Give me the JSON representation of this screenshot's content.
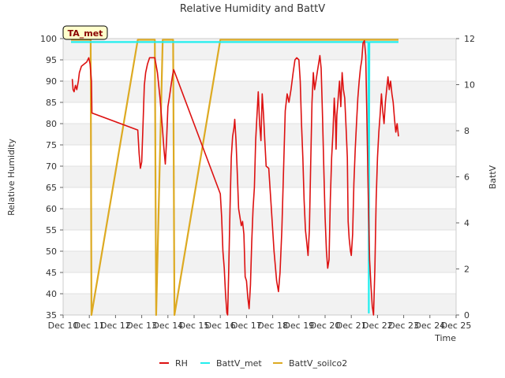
{
  "chart_data": {
    "type": "line",
    "title": "Relative Humidity and BattV",
    "xlabel": "Time",
    "ylabel": "Relative Humidity",
    "y2label": "BattV",
    "annotation": "TA_met",
    "x_range": [
      10,
      25
    ],
    "xtick_labels": [
      "Dec 10",
      "Dec 11",
      "Dec 12",
      "Dec 13",
      "Dec 14",
      "Dec 15",
      "Dec 16",
      "Dec 17",
      "Dec 18",
      "Dec 19",
      "Dec 20",
      "Dec 21",
      "Dec 22",
      "Dec 23",
      "Dec 24",
      "Dec 25"
    ],
    "ylim": [
      35,
      100
    ],
    "yticks": [
      35,
      40,
      45,
      50,
      55,
      60,
      65,
      70,
      75,
      80,
      85,
      90,
      95,
      100
    ],
    "y2lim": [
      0,
      12
    ],
    "y2ticks": [
      0,
      2,
      4,
      6,
      8,
      10,
      12
    ],
    "grid": "horizontal bands",
    "legend_position": "bottom-center",
    "series": [
      {
        "name": "RH",
        "axis": "left",
        "color": "#dd1111",
        "points": [
          [
            10.35,
            90.5
          ],
          [
            10.38,
            88
          ],
          [
            10.42,
            87.5
          ],
          [
            10.47,
            89
          ],
          [
            10.52,
            88
          ],
          [
            10.58,
            90
          ],
          [
            10.62,
            92
          ],
          [
            10.7,
            93.5
          ],
          [
            10.8,
            94
          ],
          [
            10.9,
            94.5
          ],
          [
            10.98,
            95.5
          ],
          [
            11.03,
            94
          ],
          [
            11.08,
            90
          ],
          [
            11.1,
            82.5
          ],
          [
            12.85,
            78.5
          ],
          [
            12.9,
            73
          ],
          [
            12.95,
            69.5
          ],
          [
            13.0,
            71
          ],
          [
            13.05,
            80
          ],
          [
            13.1,
            89
          ],
          [
            13.15,
            92
          ],
          [
            13.22,
            94
          ],
          [
            13.3,
            95.5
          ],
          [
            13.4,
            95.5
          ],
          [
            13.5,
            95.5
          ],
          [
            13.6,
            92
          ],
          [
            13.7,
            86
          ],
          [
            13.8,
            78
          ],
          [
            13.85,
            74
          ],
          [
            13.9,
            70.5
          ],
          [
            13.95,
            76
          ],
          [
            14.0,
            84
          ],
          [
            14.05,
            86
          ],
          [
            14.12,
            89
          ],
          [
            14.18,
            91.5
          ],
          [
            14.22,
            92.7
          ],
          [
            16.0,
            63.5
          ],
          [
            16.05,
            58
          ],
          [
            16.1,
            50
          ],
          [
            16.15,
            46
          ],
          [
            16.2,
            40
          ],
          [
            16.25,
            35.5
          ],
          [
            16.28,
            35
          ],
          [
            16.32,
            45
          ],
          [
            16.37,
            60
          ],
          [
            16.42,
            72
          ],
          [
            16.47,
            77
          ],
          [
            16.52,
            79
          ],
          [
            16.55,
            81
          ],
          [
            16.6,
            76
          ],
          [
            16.65,
            68
          ],
          [
            16.7,
            60
          ],
          [
            16.75,
            58
          ],
          [
            16.8,
            56
          ],
          [
            16.85,
            57
          ],
          [
            16.9,
            54
          ],
          [
            16.95,
            44
          ],
          [
            17.0,
            43
          ],
          [
            17.05,
            39
          ],
          [
            17.1,
            36.5
          ],
          [
            17.15,
            42
          ],
          [
            17.2,
            52
          ],
          [
            17.25,
            60
          ],
          [
            17.3,
            65
          ],
          [
            17.35,
            76
          ],
          [
            17.4,
            82
          ],
          [
            17.45,
            87.5
          ],
          [
            17.5,
            80
          ],
          [
            17.55,
            76
          ],
          [
            17.6,
            87
          ],
          [
            17.65,
            82
          ],
          [
            17.7,
            76
          ],
          [
            17.75,
            70
          ],
          [
            17.85,
            69.5
          ],
          [
            17.95,
            60
          ],
          [
            18.05,
            50
          ],
          [
            18.15,
            43
          ],
          [
            18.22,
            40.5
          ],
          [
            18.28,
            45
          ],
          [
            18.35,
            55
          ],
          [
            18.42,
            70
          ],
          [
            18.48,
            83
          ],
          [
            18.55,
            87
          ],
          [
            18.62,
            85
          ],
          [
            18.7,
            88
          ],
          [
            18.78,
            92
          ],
          [
            18.85,
            95
          ],
          [
            18.92,
            95.5
          ],
          [
            19.0,
            95
          ],
          [
            19.05,
            90
          ],
          [
            19.1,
            80
          ],
          [
            19.15,
            72
          ],
          [
            19.2,
            62
          ],
          [
            19.25,
            55
          ],
          [
            19.3,
            52
          ],
          [
            19.35,
            49
          ],
          [
            19.4,
            55
          ],
          [
            19.45,
            70
          ],
          [
            19.5,
            85
          ],
          [
            19.55,
            92
          ],
          [
            19.6,
            88
          ],
          [
            19.65,
            90
          ],
          [
            19.7,
            92
          ],
          [
            19.75,
            94
          ],
          [
            19.8,
            96
          ],
          [
            19.85,
            93
          ],
          [
            19.9,
            82
          ],
          [
            19.95,
            70
          ],
          [
            20.0,
            58
          ],
          [
            20.05,
            50
          ],
          [
            20.1,
            46
          ],
          [
            20.15,
            48
          ],
          [
            20.2,
            62
          ],
          [
            20.25,
            72
          ],
          [
            20.3,
            78
          ],
          [
            20.35,
            86
          ],
          [
            20.4,
            80
          ],
          [
            20.42,
            74
          ],
          [
            20.45,
            82
          ],
          [
            20.5,
            86
          ],
          [
            20.55,
            90
          ],
          [
            20.6,
            84
          ],
          [
            20.65,
            92
          ],
          [
            20.7,
            88
          ],
          [
            20.75,
            86
          ],
          [
            20.8,
            79
          ],
          [
            20.85,
            72
          ],
          [
            20.88,
            57
          ],
          [
            20.92,
            53
          ],
          [
            20.97,
            50
          ],
          [
            21.0,
            49
          ],
          [
            21.05,
            54
          ],
          [
            21.1,
            66
          ],
          [
            21.15,
            74
          ],
          [
            21.2,
            80
          ],
          [
            21.25,
            86
          ],
          [
            21.3,
            90
          ],
          [
            21.35,
            93
          ],
          [
            21.4,
            95
          ],
          [
            21.45,
            99
          ],
          [
            21.5,
            99.5
          ],
          [
            21.55,
            96
          ],
          [
            21.6,
            80
          ],
          [
            21.65,
            62
          ],
          [
            21.7,
            48
          ],
          [
            21.75,
            42
          ],
          [
            21.8,
            37
          ],
          [
            21.85,
            35
          ],
          [
            21.9,
            46
          ],
          [
            21.95,
            62
          ],
          [
            22.0,
            72
          ],
          [
            22.05,
            78
          ],
          [
            22.1,
            82
          ],
          [
            22.15,
            87
          ],
          [
            22.2,
            83
          ],
          [
            22.25,
            80
          ],
          [
            22.3,
            85
          ],
          [
            22.35,
            88
          ],
          [
            22.4,
            91
          ],
          [
            22.45,
            88
          ],
          [
            22.5,
            90
          ],
          [
            22.55,
            87
          ],
          [
            22.6,
            85
          ],
          [
            22.65,
            81
          ],
          [
            22.7,
            78
          ],
          [
            22.75,
            80
          ],
          [
            22.8,
            77
          ]
        ]
      },
      {
        "name": "BattV_met",
        "axis": "right",
        "color": "#22eeee",
        "points": [
          [
            10.3,
            11.85
          ],
          [
            10.7,
            11.85
          ],
          [
            11.0,
            11.85
          ],
          [
            12.85,
            11.85
          ],
          [
            13.5,
            11.85
          ],
          [
            13.8,
            11.85
          ],
          [
            14.25,
            11.85
          ],
          [
            16.0,
            11.85
          ],
          [
            16.3,
            11.85
          ],
          [
            17.0,
            11.85
          ],
          [
            18.0,
            11.85
          ],
          [
            19.0,
            11.85
          ],
          [
            20.0,
            11.85
          ],
          [
            21.0,
            11.85
          ],
          [
            21.65,
            11.85
          ],
          [
            21.67,
            0.1
          ],
          [
            21.69,
            11.85
          ],
          [
            22.0,
            11.85
          ],
          [
            22.8,
            11.85
          ]
        ]
      },
      {
        "name": "BattV_soilco2",
        "axis": "right",
        "color": "#ddaa22",
        "points": [
          [
            10.3,
            11.95
          ],
          [
            11.05,
            11.95
          ],
          [
            11.08,
            0.0
          ],
          [
            12.85,
            11.95
          ],
          [
            13.5,
            11.95
          ],
          [
            13.55,
            0.0
          ],
          [
            13.8,
            11.95
          ],
          [
            14.2,
            11.95
          ],
          [
            14.25,
            0.0
          ],
          [
            16.0,
            11.95
          ],
          [
            17.0,
            11.95
          ],
          [
            18.0,
            11.95
          ],
          [
            19.0,
            11.95
          ],
          [
            20.0,
            11.95
          ],
          [
            21.0,
            11.95
          ],
          [
            22.0,
            11.95
          ],
          [
            22.8,
            11.95
          ]
        ]
      }
    ]
  }
}
